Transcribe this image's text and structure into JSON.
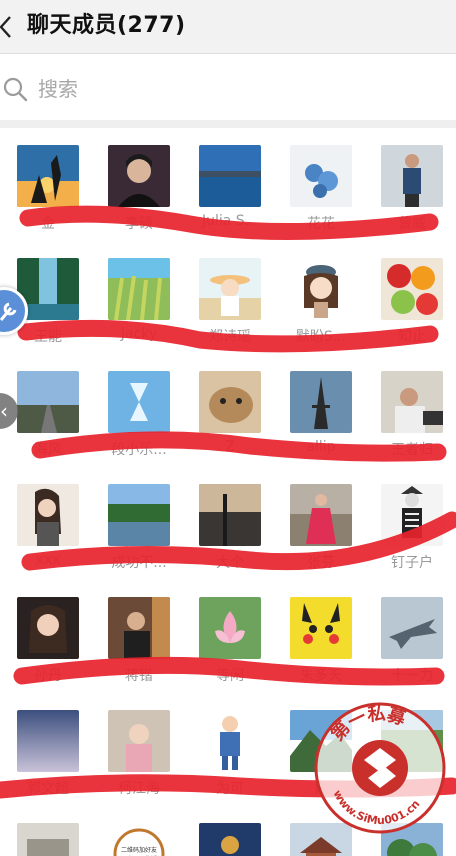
{
  "header": {
    "title": "聊天成员(277)"
  },
  "search": {
    "placeholder": "搜索"
  },
  "members": [
    {
      "name": "金",
      "avatar": "silhouette-sunset"
    },
    {
      "name": "李硕",
      "avatar": "man-portrait-dark"
    },
    {
      "name": "Julia S...",
      "avatar": "lake-landscape"
    },
    {
      "name": "花花",
      "avatar": "blue-flowers"
    },
    {
      "name": "曾威",
      "avatar": "man-standing-street"
    },
    {
      "name": "王能",
      "avatar": "waterfall"
    },
    {
      "name": "Jacky",
      "avatar": "wheat-field"
    },
    {
      "name": "郑诗瑶",
      "avatar": "girl-hat-cartoon"
    },
    {
      "name": "默盼S...",
      "avatar": "cartoon-girl-beret"
    },
    {
      "name": "知止",
      "avatar": "fruits"
    },
    {
      "name": "海风",
      "avatar": "road-sky"
    },
    {
      "name": "段小乐...",
      "avatar": "hourglass-blue"
    },
    {
      "name": "Z",
      "avatar": "cat-closeup"
    },
    {
      "name": "allip",
      "avatar": "eiffel-tower"
    },
    {
      "name": "王者归",
      "avatar": "man-office"
    },
    {
      "name": "xxx",
      "avatar": "woman-phone"
    },
    {
      "name": "成功不...",
      "avatar": "lakeside-trees"
    },
    {
      "name": "大个",
      "avatar": "dusk-balcony"
    },
    {
      "name": "张芬",
      "avatar": "woman-red-dress"
    },
    {
      "name": "钉子户",
      "avatar": "skeleton-figure"
    },
    {
      "name": "孙丹",
      "avatar": "woman-portrait"
    },
    {
      "name": "蒋锴",
      "avatar": "man-restaurant"
    },
    {
      "name": "等闲",
      "avatar": "lotus"
    },
    {
      "name": "朱多天",
      "avatar": "pikachu"
    },
    {
      "name": "十一力",
      "avatar": "fighter-jet"
    },
    {
      "name": "郭文超",
      "avatar": "blue-sky-gradient"
    },
    {
      "name": "柯江海",
      "avatar": "baby-photo"
    },
    {
      "name": "为可",
      "avatar": "cartoon-man-blue"
    },
    {
      "name": "俞",
      "avatar": "mountain-view"
    },
    {
      "name": "",
      "avatar": "green-scenery"
    }
  ],
  "partial_row": [
    "building",
    "text-badge",
    "buddha-statue",
    "temple",
    "trees"
  ],
  "partial_row_texts": [
    "二维码加好友",
    "无字开心生活"
  ],
  "watermark": {
    "text": "第一私募",
    "url": "www.SiMu001.cn"
  },
  "colors": {
    "scribble": "#e8232d",
    "title_bg": "#f2f2f2",
    "name_gray": "#9a9a9a",
    "float_button": "#5b8fd8"
  }
}
